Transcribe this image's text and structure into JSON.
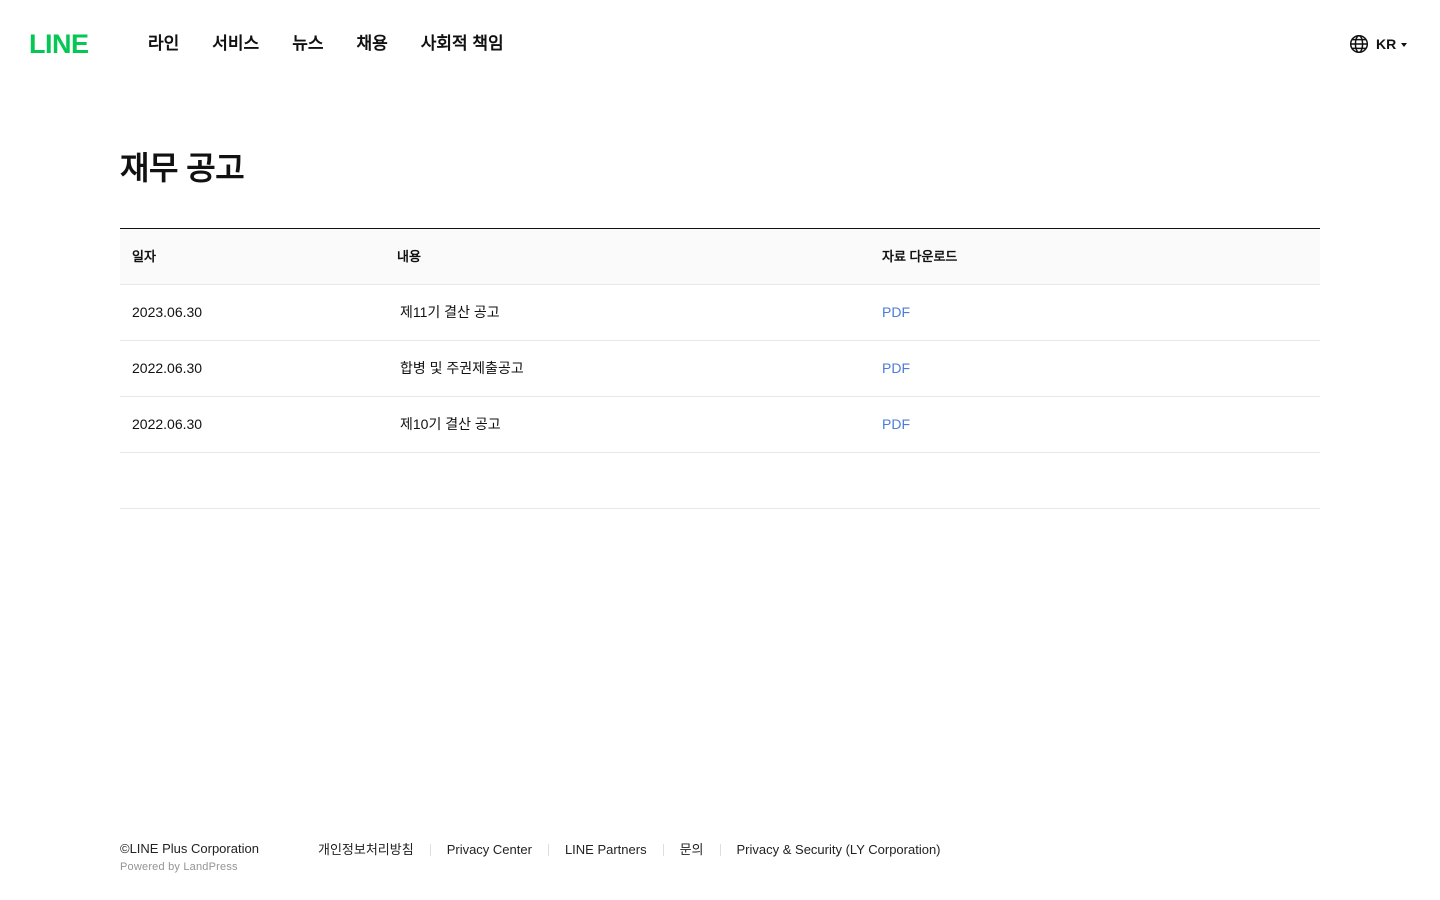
{
  "header": {
    "logo": "LINE",
    "nav": [
      "라인",
      "서비스",
      "뉴스",
      "채용",
      "사회적 책임"
    ],
    "language": "KR"
  },
  "main": {
    "title": "재무 공고",
    "table": {
      "headers": [
        "일자",
        "내용",
        "자료 다운로드"
      ],
      "rows": [
        {
          "date": "2023.06.30",
          "content": "제11기 결산 공고",
          "download": "PDF"
        },
        {
          "date": "2022.06.30",
          "content": "합병 및 주권제출공고",
          "download": "PDF"
        },
        {
          "date": "2022.06.30",
          "content": "제10기 결산 공고",
          "download": "PDF"
        }
      ]
    }
  },
  "footer": {
    "copyright": "©LINE Plus Corporation",
    "powered": "Powered by LandPress",
    "links": [
      "개인정보처리방침",
      "Privacy Center",
      "LINE Partners",
      "문의",
      "Privacy & Security (LY Corporation)"
    ]
  },
  "colors": {
    "brand": "#06c755",
    "link": "#4c7bd9"
  },
  "icons": {
    "language": "globe-icon",
    "dropdown": "caret-down-icon"
  }
}
